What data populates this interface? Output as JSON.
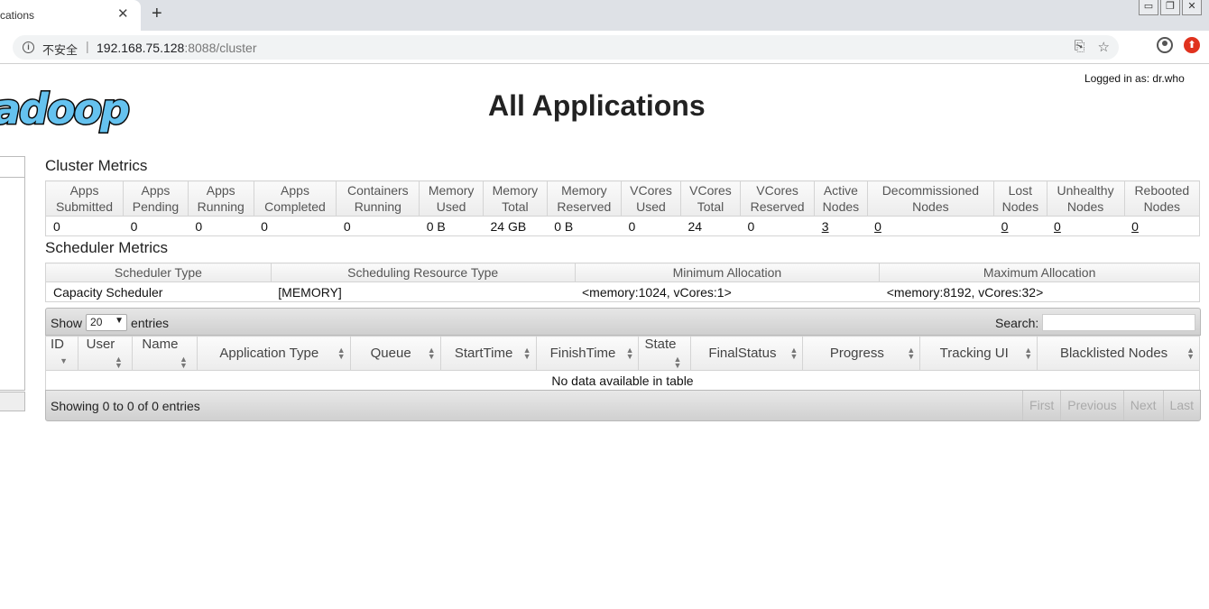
{
  "browser": {
    "tab_title": "cations",
    "tab_close": "✕",
    "new_tab": "+",
    "insecure_label": "不安全",
    "url_host": "192.168.75.128",
    "url_rest": ":8088/cluster",
    "window_buttons": [
      "▭",
      "❐",
      "✕"
    ]
  },
  "header": {
    "logged_in": "Logged in as: dr.who",
    "logo_text": "adoop",
    "title": "All Applications"
  },
  "cluster_metrics": {
    "title": "Cluster Metrics",
    "headers": [
      [
        "Apps",
        "Submitted"
      ],
      [
        "Apps",
        "Pending"
      ],
      [
        "Apps",
        "Running"
      ],
      [
        "Apps",
        "Completed"
      ],
      [
        "Containers",
        "Running"
      ],
      [
        "Memory",
        "Used"
      ],
      [
        "Memory",
        "Total"
      ],
      [
        "Memory",
        "Reserved"
      ],
      [
        "VCores",
        "Used"
      ],
      [
        "VCores",
        "Total"
      ],
      [
        "VCores",
        "Reserved"
      ],
      [
        "Active",
        "Nodes"
      ],
      [
        "Decommissioned",
        "Nodes"
      ],
      [
        "Lost",
        "Nodes"
      ],
      [
        "Unhealthy",
        "Nodes"
      ],
      [
        "Rebooted",
        "Nodes"
      ]
    ],
    "values": [
      "0",
      "0",
      "0",
      "0",
      "0",
      "0 B",
      "24 GB",
      "0 B",
      "0",
      "24",
      "0",
      "3",
      "0",
      "0",
      "0",
      "0"
    ]
  },
  "scheduler_metrics": {
    "title": "Scheduler Metrics",
    "headers": [
      "Scheduler Type",
      "Scheduling Resource Type",
      "Minimum Allocation",
      "Maximum Allocation"
    ],
    "values": [
      "Capacity Scheduler",
      "[MEMORY]",
      "<memory:1024, vCores:1>",
      "<memory:8192, vCores:32>"
    ]
  },
  "apps_table": {
    "show_label": "Show",
    "page_size": "20",
    "entries_label": "entries",
    "search_label": "Search:",
    "columns": [
      "ID",
      "User",
      "Name",
      "Application Type",
      "Queue",
      "StartTime",
      "FinishTime",
      "State",
      "FinalStatus",
      "Progress",
      "Tracking UI",
      "Blacklisted Nodes"
    ],
    "empty_message": "No data available in table",
    "info": "Showing 0 to 0 of 0 entries",
    "pager": [
      "First",
      "Previous",
      "Next",
      "Last"
    ]
  }
}
